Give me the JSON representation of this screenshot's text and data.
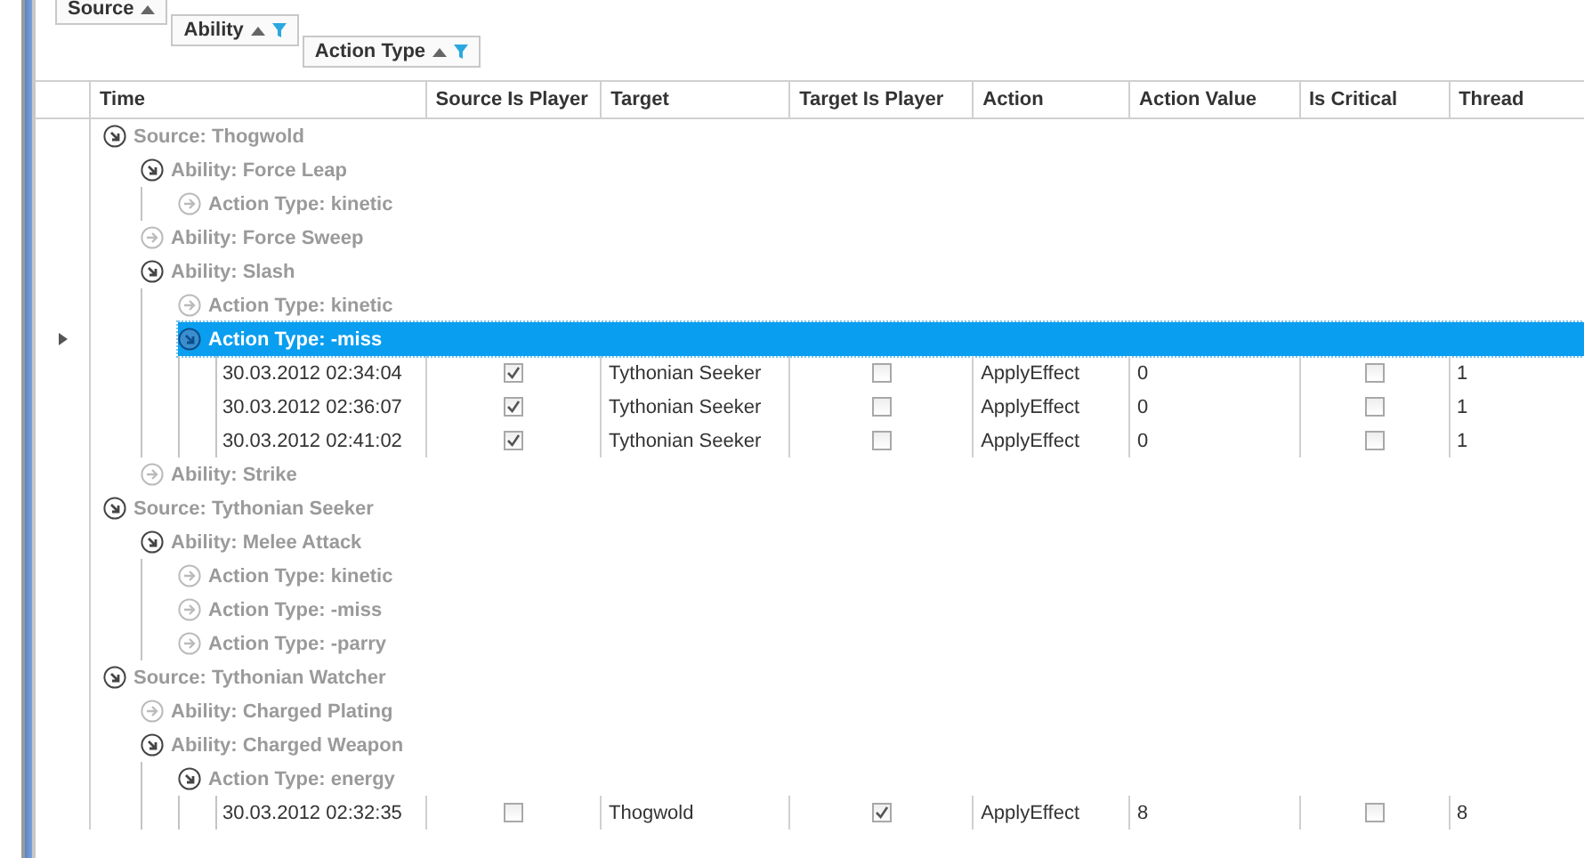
{
  "group_panel": [
    {
      "label": "Source",
      "filtered": false
    },
    {
      "label": "Ability",
      "filtered": true
    },
    {
      "label": "Action Type",
      "filtered": true
    }
  ],
  "columns": [
    "Time",
    "Source Is Player",
    "Target",
    "Target Is Player",
    "Action",
    "Action Value",
    "Is Critical",
    "Thread"
  ],
  "groups": [
    {
      "label": "Source: Thogwold",
      "expanded": true,
      "selected": false,
      "children": [
        {
          "label": "Ability: Force Leap",
          "expanded": true,
          "selected": false,
          "children": [
            {
              "label": "Action Type: kinetic",
              "expanded": false,
              "selected": false
            }
          ]
        },
        {
          "label": "Ability: Force Sweep",
          "expanded": false,
          "selected": false
        },
        {
          "label": "Ability: Slash",
          "expanded": true,
          "selected": false,
          "children": [
            {
              "label": "Action Type: kinetic",
              "expanded": false,
              "selected": false
            },
            {
              "label": "Action Type: -miss",
              "expanded": true,
              "selected": true,
              "rows": [
                {
                  "time": "30.03.2012 02:34:04",
                  "source_is_player": true,
                  "target": "Tythonian Seeker",
                  "target_is_player": false,
                  "action": "ApplyEffect",
                  "action_value": "0",
                  "is_critical": false,
                  "thread": "1"
                },
                {
                  "time": "30.03.2012 02:36:07",
                  "source_is_player": true,
                  "target": "Tythonian Seeker",
                  "target_is_player": false,
                  "action": "ApplyEffect",
                  "action_value": "0",
                  "is_critical": false,
                  "thread": "1"
                },
                {
                  "time": "30.03.2012 02:41:02",
                  "source_is_player": true,
                  "target": "Tythonian Seeker",
                  "target_is_player": false,
                  "action": "ApplyEffect",
                  "action_value": "0",
                  "is_critical": false,
                  "thread": "1"
                }
              ]
            }
          ]
        },
        {
          "label": "Ability: Strike",
          "expanded": false,
          "selected": false
        }
      ]
    },
    {
      "label": "Source: Tythonian Seeker",
      "expanded": true,
      "selected": false,
      "children": [
        {
          "label": "Ability: Melee Attack",
          "expanded": true,
          "selected": false,
          "children": [
            {
              "label": "Action Type: kinetic",
              "expanded": false,
              "selected": false
            },
            {
              "label": "Action Type: -miss",
              "expanded": false,
              "selected": false
            },
            {
              "label": "Action Type: -parry",
              "expanded": false,
              "selected": false
            }
          ]
        }
      ]
    },
    {
      "label": "Source: Tythonian Watcher",
      "expanded": true,
      "selected": false,
      "children": [
        {
          "label": "Ability: Charged Plating",
          "expanded": false,
          "selected": false
        },
        {
          "label": "Ability: Charged Weapon",
          "expanded": true,
          "selected": false,
          "children": [
            {
              "label": "Action Type: energy",
              "expanded": true,
              "selected": false,
              "rows": [
                {
                  "time": "30.03.2012 02:32:35",
                  "source_is_player": false,
                  "target": "Thogwold",
                  "target_is_player": true,
                  "action": "ApplyEffect",
                  "action_value": "8",
                  "is_critical": false,
                  "thread": "8"
                }
              ]
            }
          ]
        }
      ]
    }
  ]
}
